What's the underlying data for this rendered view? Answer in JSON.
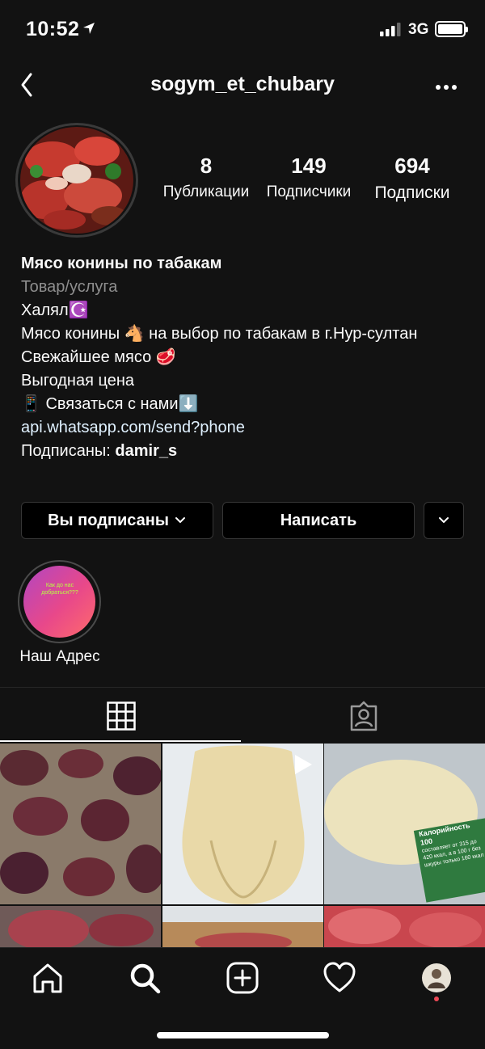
{
  "status": {
    "time": "10:52",
    "network": "3G"
  },
  "header": {
    "username": "sogym_et_chubary"
  },
  "stats": [
    {
      "value": "8",
      "label": "Публикации"
    },
    {
      "value": "149",
      "label": "Подписчики"
    },
    {
      "value": "694",
      "label": "Подписки"
    }
  ],
  "bio": {
    "name": "Мясо конины по табакам",
    "category": "Товар/услуга",
    "lines": [
      "Халял☪️",
      "Мясо конины 🐴 на выбор по табакам в г.Нур-султан",
      "Свежайшее мясо 🥩",
      "Выгодная цена",
      "📱 Связаться с нами⬇️"
    ],
    "link": "api.whatsapp.com/send?phone",
    "followed_by_prefix": "Подписаны: ",
    "followed_by_user": "damir_s"
  },
  "buttons": {
    "following": "Вы подписаны",
    "message": "Написать"
  },
  "highlight": {
    "label": "Наш Адрес",
    "cover_text": "Как до нас добраться???"
  },
  "grid_overlay": {
    "calorie_text": "Калорийность 100",
    "calorie_sub": "составляет от 315 до 420 ккал, а в 100 г без шкуры только 160 ккал"
  },
  "icons": {
    "back": "chevron-left-icon",
    "more": "more-dots-icon",
    "grid": "grid-icon",
    "tagged": "tagged-person-icon",
    "home": "home-icon",
    "search": "search-icon",
    "add": "add-post-icon",
    "activity": "heart-icon",
    "profile": "profile-avatar-icon"
  }
}
